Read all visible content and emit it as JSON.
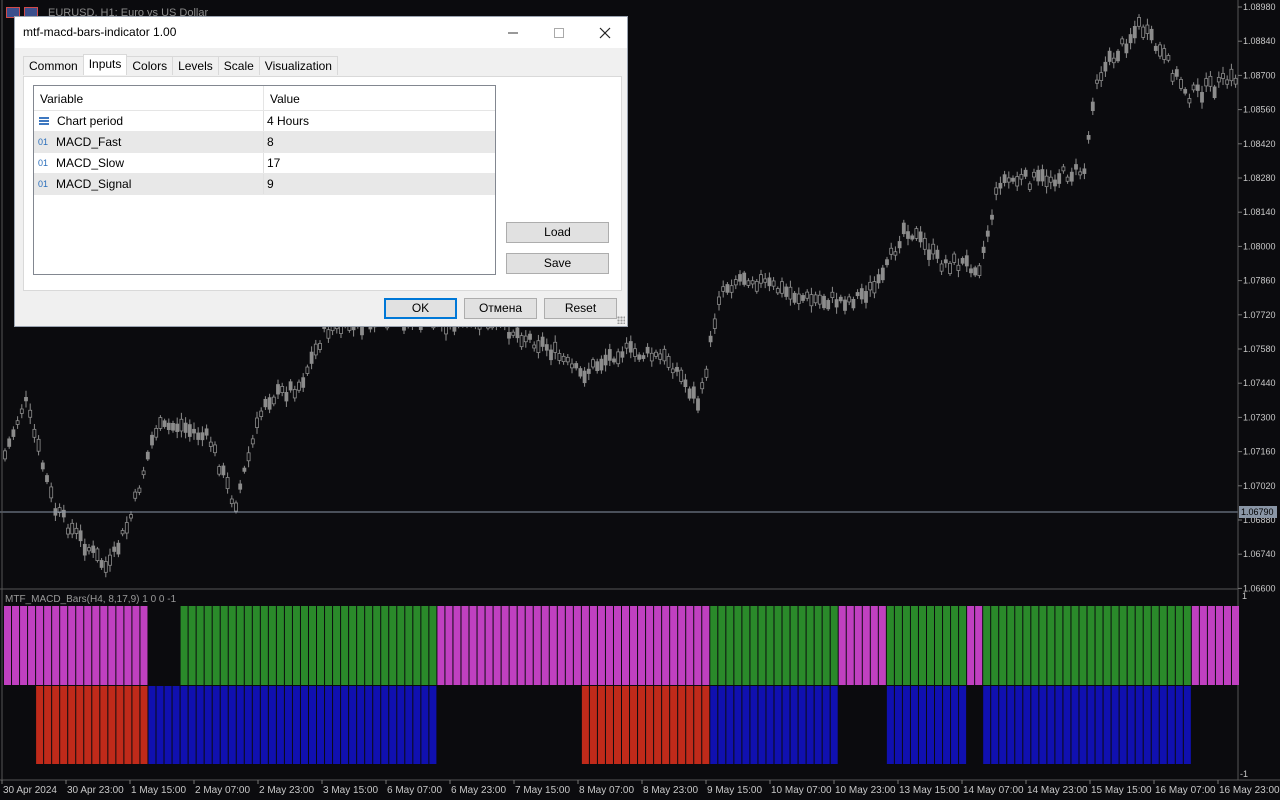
{
  "chart": {
    "title": "EURUSD, H1:  Euro vs US Dollar",
    "indicator_label": "MTF_MACD_Bars(H4, 8,17,9) 1 0 0 -1",
    "price_labels": [
      "1.08980",
      "1.08840",
      "1.08700",
      "1.08560",
      "1.08420",
      "1.08280",
      "1.08140",
      "1.08000",
      "1.07860",
      "1.07720",
      "1.07580",
      "1.07440",
      "1.07300",
      "1.07160",
      "1.07020",
      "1.06880",
      "1.06740",
      "1.06600"
    ],
    "current_price": "1.06790",
    "indicator_scale": [
      "1",
      "-1"
    ],
    "time_labels": [
      "30 Apr 2024",
      "30 Apr 23:00",
      "1 May 15:00",
      "2 May 07:00",
      "2 May 23:00",
      "3 May 15:00",
      "6 May 07:00",
      "6 May 23:00",
      "7 May 15:00",
      "8 May 07:00",
      "8 May 23:00",
      "9 May 15:00",
      "10 May 07:00",
      "10 May 23:00",
      "13 May 15:00",
      "14 May 07:00",
      "14 May 23:00",
      "15 May 15:00",
      "16 May 07:00",
      "16 May 23:00"
    ],
    "colors": {
      "bull_upper": "#c040c0",
      "bull_upper_alt": "#2a8a2a",
      "lower_red": "#c02a1a",
      "lower_blue": "#1010b0",
      "candle": "#8c8c8c",
      "axis_text": "#c8c8c8"
    },
    "indicator_segments": [
      {
        "upper": "magenta",
        "lower": "none",
        "bars": 4
      },
      {
        "upper": "magenta",
        "lower": "red",
        "bars": 14
      },
      {
        "upper": "none",
        "lower": "blue",
        "bars": 4
      },
      {
        "upper": "green",
        "lower": "blue",
        "bars": 32
      },
      {
        "upper": "magenta",
        "lower": "none",
        "bars": 18
      },
      {
        "upper": "magenta",
        "lower": "red",
        "bars": 16
      },
      {
        "upper": "green",
        "lower": "blue",
        "bars": 16
      },
      {
        "upper": "magenta",
        "lower": "none",
        "bars": 6
      },
      {
        "upper": "green",
        "lower": "blue",
        "bars": 10
      },
      {
        "upper": "magenta",
        "lower": "none",
        "bars": 2
      },
      {
        "upper": "green",
        "lower": "blue",
        "bars": 26
      },
      {
        "upper": "magenta",
        "lower": "none",
        "bars": 6
      }
    ]
  },
  "dialog": {
    "title": "mtf-macd-bars-indicator 1.00",
    "tabs": [
      "Common",
      "Inputs",
      "Colors",
      "Levels",
      "Scale",
      "Visualization"
    ],
    "active_tab": "Inputs",
    "columns": [
      "Variable",
      "Value"
    ],
    "rows": [
      {
        "type": "enum",
        "name": "Chart period",
        "value": "4 Hours"
      },
      {
        "type": "01",
        "name": "MACD_Fast",
        "value": "8"
      },
      {
        "type": "01",
        "name": "MACD_Slow",
        "value": "17"
      },
      {
        "type": "01",
        "name": "MACD_Signal",
        "value": "9"
      }
    ],
    "buttons": {
      "load": "Load",
      "save": "Save",
      "ok": "OK",
      "cancel": "Отмена",
      "reset": "Reset"
    }
  }
}
